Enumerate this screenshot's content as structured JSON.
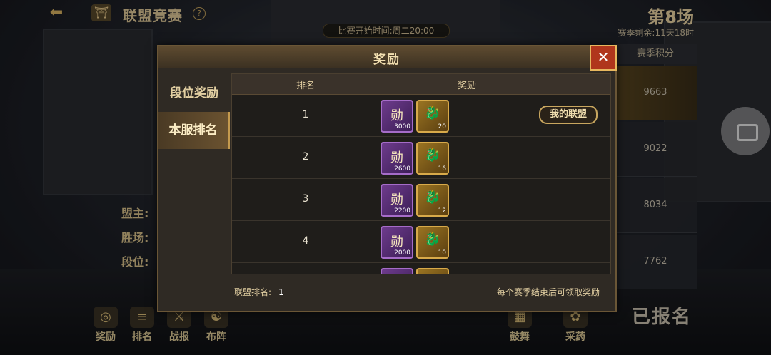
{
  "top": {
    "title": "联盟竞赛",
    "match": "第8场",
    "season_left": "赛季剩余:11天18时",
    "start_time": "比赛开始时间:周二20:00"
  },
  "score": {
    "header": "赛季积分",
    "values": [
      "9663",
      "9022",
      "8034",
      "7762"
    ]
  },
  "left_info": [
    "盟主:",
    "胜场:",
    "段位:"
  ],
  "bottom_left": [
    {
      "label": "奖励",
      "icon": "reward-icon",
      "glyph": "◎"
    },
    {
      "label": "排名",
      "icon": "ranking-icon",
      "glyph": "≡"
    },
    {
      "label": "战报",
      "icon": "battle-report-icon",
      "glyph": "⚔"
    },
    {
      "label": "布阵",
      "icon": "formation-icon",
      "glyph": "☯"
    }
  ],
  "bottom_right": [
    {
      "label": "鼓舞",
      "icon": "inspire-icon",
      "glyph": "▦"
    },
    {
      "label": "采药",
      "icon": "herb-icon",
      "glyph": "✿"
    }
  ],
  "registered": "已报名",
  "modal": {
    "title": "奖励",
    "tabs": [
      "段位奖励",
      "本服排名"
    ],
    "active_tab": "本服排名",
    "columns": [
      "排名",
      "奖励"
    ],
    "rows": [
      {
        "rank": "1",
        "item1": "3000",
        "item2": "20"
      },
      {
        "rank": "2",
        "item1": "2600",
        "item2": "16"
      },
      {
        "rank": "3",
        "item1": "2200",
        "item2": "12"
      },
      {
        "rank": "4",
        "item1": "2000",
        "item2": "10"
      }
    ],
    "item_glyph": "勋",
    "my_alliance": "我的联盟",
    "footer_label": "联盟排名:",
    "footer_value": "1",
    "footer_note": "每个赛季结束后可领取奖励"
  },
  "colors": {
    "accent": "#c9a75f",
    "close": "#b0361c",
    "purple_item": "#6d3b8c",
    "gold_item": "#9a7422"
  }
}
